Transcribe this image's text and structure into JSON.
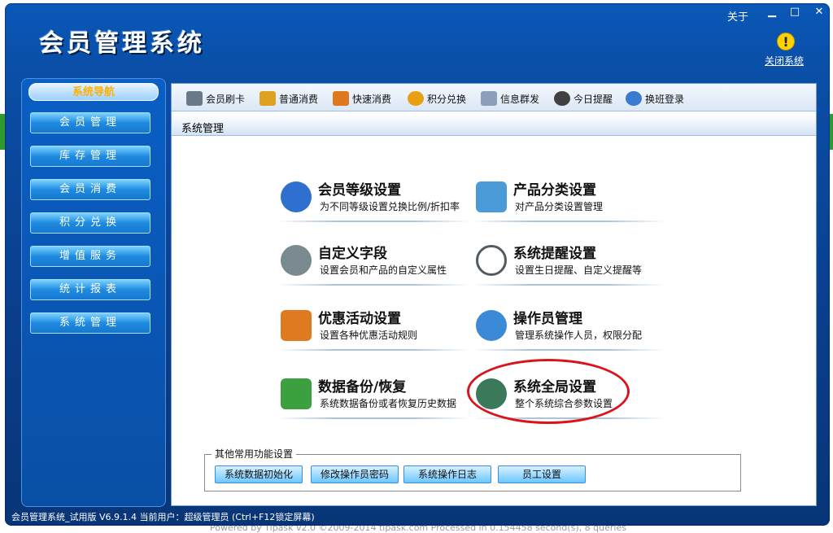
{
  "header": {
    "app_title": "会员管理系统",
    "about": "关于",
    "min_glyph": "▁",
    "max_glyph": "□",
    "close_glyph": "✕",
    "warn_glyph": "!",
    "close_system": "关闭系统"
  },
  "sidebar": {
    "title": "系统导航",
    "items": [
      {
        "label": "会员管理"
      },
      {
        "label": "库存管理"
      },
      {
        "label": "会员消费"
      },
      {
        "label": "积分兑换"
      },
      {
        "label": "增值服务"
      },
      {
        "label": "统计报表"
      },
      {
        "label": "系统管理"
      }
    ]
  },
  "toolbar": {
    "items": [
      {
        "label": "会员刷卡",
        "icon": "card-icon",
        "color": "#6b7a8a"
      },
      {
        "label": "普通消费",
        "icon": "money-bag-icon",
        "color": "#e0a020"
      },
      {
        "label": "快速消费",
        "icon": "fast-pay-icon",
        "color": "#e07820"
      },
      {
        "label": "积分兑换",
        "icon": "exchange-icon",
        "color": "#e8a010"
      },
      {
        "label": "信息群发",
        "icon": "mail-icon",
        "color": "#8aa0b8"
      },
      {
        "label": "今日提醒",
        "icon": "clock-icon",
        "color": "#404040"
      },
      {
        "label": "换班登录",
        "icon": "switch-icon",
        "color": "#3a7ad0"
      }
    ]
  },
  "section": {
    "title": "系统管理"
  },
  "features": [
    {
      "title": "会员等级设置",
      "desc": "为不同等级设置兑换比例/折扣率",
      "icon": "user-level-icon",
      "color": "#2f6fd0"
    },
    {
      "title": "产品分类设置",
      "desc": "对产品分类设置管理",
      "icon": "product-category-icon",
      "color": "#4a9ad8"
    },
    {
      "title": "自定义字段",
      "desc": "设置会员和产品的自定义属性",
      "icon": "gear-icon",
      "color": "#7a8a90"
    },
    {
      "title": "系统提醒设置",
      "desc": "设置生日提醒、自定义提醒等",
      "icon": "clock-icon",
      "color": "#505a60"
    },
    {
      "title": "优惠活动设置",
      "desc": "设置各种优惠活动规则",
      "icon": "gift-icon",
      "color": "#e07a20"
    },
    {
      "title": "操作员管理",
      "desc": "管理系统操作人员，权限分配",
      "icon": "operator-icon",
      "color": "#3a8ad8"
    },
    {
      "title": "数据备份/恢复",
      "desc": "系统数据备份或者恢复历史数据",
      "icon": "backup-icon",
      "color": "#3aa040"
    },
    {
      "title": "系统全局设置",
      "desc": "整个系统综合参数设置",
      "icon": "globe-icon",
      "color": "#3a7a5a"
    }
  ],
  "other": {
    "legend": "其他常用功能设置",
    "buttons": [
      {
        "label": "系统数据初始化"
      },
      {
        "label": "修改操作员密码"
      },
      {
        "label": "系统操作日志"
      },
      {
        "label": "员工设置"
      }
    ]
  },
  "status": {
    "text": "会员管理系统_试用版 V6.9.1.4 当前用户：超级管理员 (Ctrl+F12锁定屏幕)"
  },
  "underlay": {
    "text": "Powered by Tipask v2.0 ©2009-2014 tipask.com    Processed in 0.154458 second(s), 8 queries"
  }
}
